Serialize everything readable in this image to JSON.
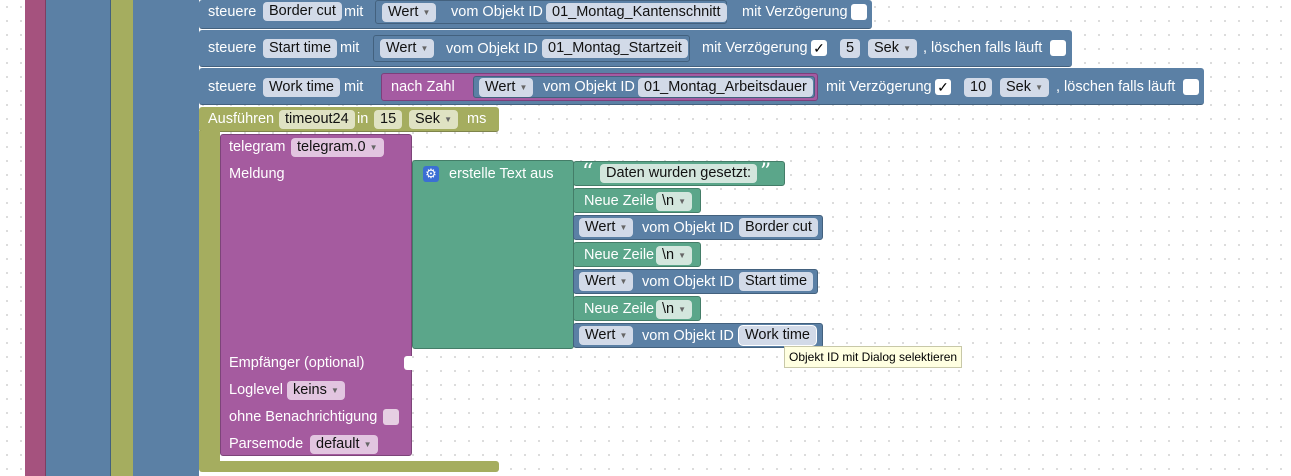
{
  "colors": {
    "control_purple": "#a5527e",
    "olive": "#a5ad5f",
    "blue": "#5b80a5",
    "green": "#5ba68a",
    "telegram_purple": "#a55b9f",
    "conversion_purple": "#a55ba2"
  },
  "set_blocks": [
    {
      "keyword": "steuere",
      "state": "Border cut",
      "with": "mit",
      "value_label": "Wert",
      "of_object": "vom Objekt ID",
      "object_id": "01_Montag_Kantenschnitt",
      "delay_label": "mit Verzögerung"
    },
    {
      "keyword": "steuere",
      "state": "Start time",
      "with": "mit",
      "value_label": "Wert",
      "of_object": "vom Objekt ID",
      "object_id": "01_Montag_Startzeit",
      "delay_label": "mit Verzögerung",
      "delay_checked": "✓",
      "delay_value": "5",
      "delay_unit": "Sek",
      "clear_label": ", löschen falls läuft"
    },
    {
      "keyword": "steuere",
      "state": "Work time",
      "with": "mit",
      "conversion": "nach Zahl",
      "value_label": "Wert",
      "of_object": "vom Objekt ID",
      "object_id": "01_Montag_Arbeitsdauer",
      "delay_label": "mit Verzögerung",
      "delay_checked": "✓",
      "delay_value": "10",
      "delay_unit": "Sek",
      "clear_label": ", löschen falls läuft"
    }
  ],
  "timeout_block": {
    "label": "Ausführen",
    "name": "timeout24",
    "in_label": "in",
    "value": "15",
    "unit": "Sek",
    "ms_label": "ms"
  },
  "telegram_block": {
    "label": "telegram",
    "instance": "telegram.0",
    "message_label": "Meldung",
    "recipient_label": "Empfänger (optional)",
    "loglevel_label": "Loglevel",
    "loglevel_value": "keins",
    "silent_label": "ohne Benachrichtigung",
    "parsemode_label": "Parsemode",
    "parsemode_value": "default"
  },
  "text_join": {
    "label": "erstelle Text aus",
    "quote_open": "“",
    "quote_close": "”",
    "text_value": "Daten wurden gesetzt:",
    "newline_label": "Neue Zeile",
    "newline_value": "\\n",
    "value_label": "Wert",
    "of_object": "vom Objekt ID",
    "items": [
      "Border cut",
      "Start time",
      "Work time"
    ]
  },
  "tooltip": "Objekt ID mit Dialog selektieren"
}
